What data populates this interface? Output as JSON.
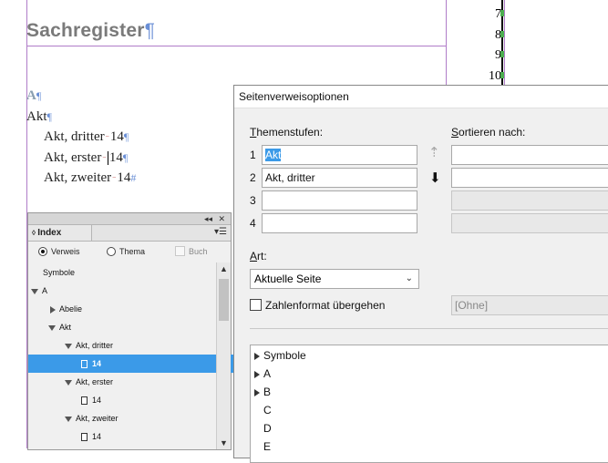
{
  "document": {
    "heading": "Sachregister",
    "pilcrow": "¶",
    "line_numbers": [
      "7",
      "8",
      "9",
      "10"
    ],
    "section_letter": "A",
    "entries": [
      {
        "text": "Akt",
        "page": "",
        "indent": 0
      },
      {
        "text": "Akt, dritter",
        "page": "14",
        "indent": 1
      },
      {
        "text": "Akt, erster",
        "page": "14",
        "indent": 1
      },
      {
        "text": "Akt, zweiter",
        "page": "14",
        "indent": 1
      }
    ],
    "end_mark": "#"
  },
  "index_panel": {
    "tab_label": "Index",
    "collapse_glyph": "◂◂",
    "close_glyph": "✕",
    "menu_glyph": "▾☰",
    "option_reference": "Verweis",
    "option_topic": "Thema",
    "option_book": "Buch",
    "rows": [
      {
        "label": "Symbole",
        "level": 0,
        "kind": "leaf-text"
      },
      {
        "label": "A",
        "level": 0,
        "kind": "expanded"
      },
      {
        "label": "Abelie",
        "level": 1,
        "kind": "collapsed"
      },
      {
        "label": "Akt",
        "level": 1,
        "kind": "expanded"
      },
      {
        "label": "Akt, dritter",
        "level": 2,
        "kind": "expanded"
      },
      {
        "label": "14",
        "level": 3,
        "kind": "page",
        "selected": true
      },
      {
        "label": "Akt, erster",
        "level": 2,
        "kind": "expanded"
      },
      {
        "label": "14",
        "level": 3,
        "kind": "page"
      },
      {
        "label": "Akt, zweiter",
        "level": 2,
        "kind": "expanded"
      },
      {
        "label": "14",
        "level": 3,
        "kind": "page"
      }
    ]
  },
  "dialog": {
    "title": "Seitenverweisoptionen",
    "topic_levels_label": "Themenstufen:",
    "topic_levels_mnemonic": "T",
    "sort_by_label": "Sortieren nach:",
    "sort_by_mnemonic": "S",
    "level_numbers": [
      "1",
      "2",
      "3",
      "4"
    ],
    "topic_values": [
      "Akt",
      "Akt, dritter",
      "",
      ""
    ],
    "move_up_glyph": "⇡",
    "move_down_glyph": "⬇",
    "type_label": "Art:",
    "type_mnemonic": "A",
    "type_value": "Aktuelle Seite",
    "override_number_format_label": "Zahlenformat übergehen",
    "number_format_value": "[Ohne]",
    "tree_items": [
      "Symbole",
      "A",
      "B",
      "C",
      "D",
      "E"
    ]
  },
  "colors": {
    "selection": "#3b9ae8",
    "guide": "#b07cc8",
    "pilcrow": "#6a8fd6"
  }
}
